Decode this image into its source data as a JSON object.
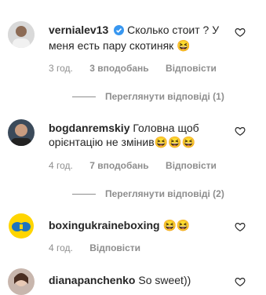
{
  "comments": [
    {
      "username": "vernialev13",
      "text": "Сколько стоит ? У меня есть пару скотиняк 😆",
      "time": "3 год.",
      "likes": "3 вподобань",
      "reply": "Відповісти",
      "view_replies": "Переглянути відповіді (1)"
    },
    {
      "username": "bogdanremskiy",
      "text": "Головна щоб орієнтацію не змінив😆😆😆",
      "time": "4 год.",
      "likes": "7 вподобань",
      "reply": "Відповісти",
      "view_replies": "Переглянути відповіді (2)"
    },
    {
      "username": "boxingukraineboxing",
      "text": "😆😆",
      "time": "4 год.",
      "reply": "Відповісти"
    },
    {
      "username": "dianapanchenko",
      "text": "So sweet))"
    }
  ],
  "colors": {
    "text": "#262626",
    "muted": "#8e8e8e",
    "verified": "#3897f0"
  }
}
